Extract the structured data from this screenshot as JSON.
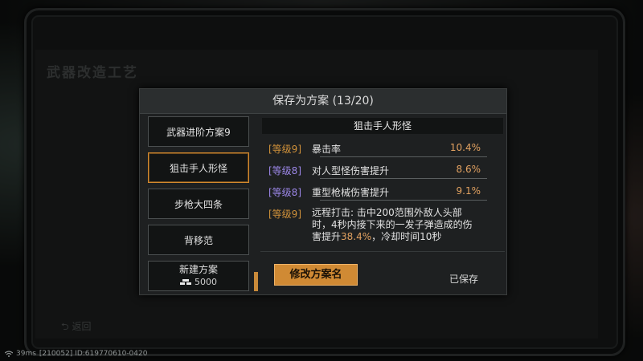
{
  "background": {
    "title": "武器改造工艺",
    "back_label": "返回"
  },
  "modal": {
    "title": "保存为方案 (13/20)",
    "plans": [
      {
        "label": "武器进阶方案9"
      },
      {
        "label": "狙击手人形怪",
        "selected": true
      },
      {
        "label": "步枪大四条"
      },
      {
        "label": "背移范"
      }
    ],
    "new_plan": {
      "label": "新建方案",
      "cost": "5000",
      "icon": "coin-stack-icon"
    },
    "detail": {
      "title": "狙击手人形怪",
      "rows": [
        {
          "level": "[等级9]",
          "level_color": "#d0913a",
          "name": "暴击率",
          "value": "10.4%"
        },
        {
          "level": "[等级8]",
          "level_color": "#9b86e6",
          "name": "对人型怪伤害提升",
          "value": "8.6%"
        },
        {
          "level": "[等级8]",
          "level_color": "#9b86e6",
          "name": "重型枪械伤害提升",
          "value": "9.1%"
        }
      ],
      "special": {
        "level": "[等级9]",
        "text_pre": "远程打击: 击中200范围外敌人头部时，4秒内接下来的一发子弹造成的伤害提升",
        "highlight": "38.4%",
        "text_post": "，冷却时间10秒"
      }
    },
    "rename_button": "修改方案名",
    "saved_label": "已保存"
  },
  "status_bar": {
    "ping": "39ms",
    "id_text": "[210052] ID:619770610-0420"
  },
  "colors": {
    "accent": "#d08a34",
    "rare": "#9b86e6",
    "value": "#e0a060"
  }
}
